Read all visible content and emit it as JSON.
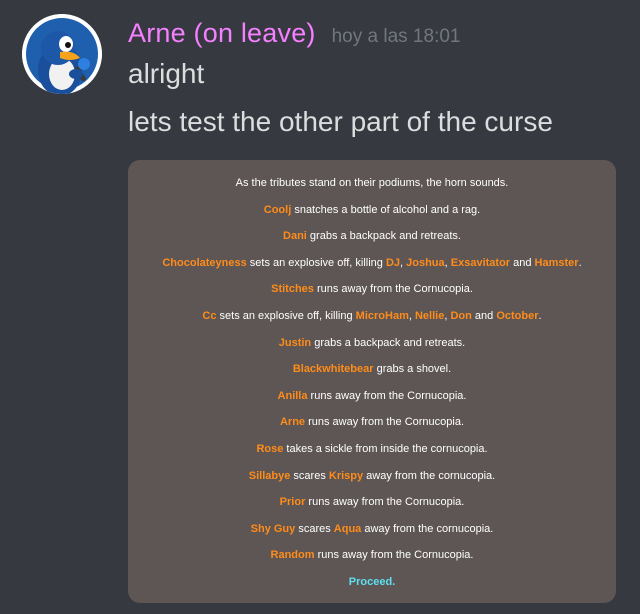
{
  "message": {
    "author": "Arne (on leave)",
    "timestamp": "hoy a las 18:01",
    "lines": [
      "alright",
      "lets test the other part of the curse"
    ],
    "author_color": "#f47fff",
    "avatar_icon": "penguin-avatar-icon"
  },
  "game": {
    "events": [
      [
        {
          "t": "As the tributes stand on their podiums, the horn sounds."
        }
      ],
      [
        {
          "n": "Coolj"
        },
        {
          "t": " snatches a bottle of alcohol and a rag."
        }
      ],
      [
        {
          "n": "Dani"
        },
        {
          "t": " grabs a backpack and retreats."
        }
      ],
      [
        {
          "n": "Chocolateyness"
        },
        {
          "t": " sets an explosive off, killing "
        },
        {
          "n": "DJ"
        },
        {
          "t": ", "
        },
        {
          "n": "Joshua"
        },
        {
          "t": ", "
        },
        {
          "n": "Exsavitator"
        },
        {
          "t": " and "
        },
        {
          "n": "Hamster"
        },
        {
          "t": "."
        }
      ],
      [
        {
          "n": "Stitches"
        },
        {
          "t": " runs away from the Cornucopia."
        }
      ],
      [
        {
          "n": "Cc"
        },
        {
          "t": " sets an explosive off, killing "
        },
        {
          "n": "MicroHam"
        },
        {
          "t": ", "
        },
        {
          "n": "Nellie"
        },
        {
          "t": ", "
        },
        {
          "n": "Don"
        },
        {
          "t": " and "
        },
        {
          "n": "October"
        },
        {
          "t": "."
        }
      ],
      [
        {
          "n": "Justin"
        },
        {
          "t": " grabs a backpack and retreats."
        }
      ],
      [
        {
          "n": "Blackwhitebear"
        },
        {
          "t": " grabs a shovel."
        }
      ],
      [
        {
          "n": "Anilla"
        },
        {
          "t": " runs away from the Cornucopia."
        }
      ],
      [
        {
          "n": "Arne"
        },
        {
          "t": " runs away from the Cornucopia."
        }
      ],
      [
        {
          "n": "Rose"
        },
        {
          "t": " takes a sickle from inside the cornucopia."
        }
      ],
      [
        {
          "n": "Sillabye"
        },
        {
          "t": " scares "
        },
        {
          "n": "Krispy"
        },
        {
          "t": " away from the cornucopia."
        }
      ],
      [
        {
          "n": "Prior"
        },
        {
          "t": " runs away from the Cornucopia."
        }
      ],
      [
        {
          "n": "Shy Guy"
        },
        {
          "t": " scares "
        },
        {
          "n": "Aqua"
        },
        {
          "t": " away from the cornucopia."
        }
      ],
      [
        {
          "n": "Random"
        },
        {
          "t": " runs away from the Cornucopia."
        }
      ]
    ],
    "proceed_label": "Proceed.",
    "box_color": "#5d5654",
    "name_color": "#ff8c1a",
    "link_color": "#5ee0f0"
  }
}
